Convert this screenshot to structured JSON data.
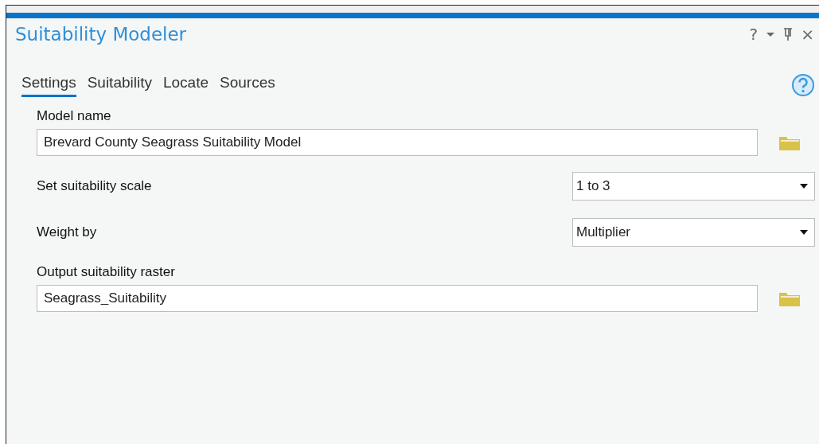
{
  "window": {
    "title": "Suitability Modeler",
    "controls": [
      "?",
      "×"
    ]
  },
  "tabs": [
    {
      "label": "Settings",
      "selected": true
    },
    {
      "label": "Suitability",
      "selected": false
    },
    {
      "label": "Locate",
      "selected": false
    },
    {
      "label": "Sources",
      "selected": false
    }
  ],
  "fields": [
    {
      "kind": "path",
      "label": "Model name",
      "value": "Brevard County Seagrass Suitability Model"
    },
    {
      "kind": "dropdown",
      "label": "Set suitability scale",
      "value": "1 to 3"
    },
    {
      "kind": "dropdown",
      "label": "Weight by",
      "value": "Multiplier"
    },
    {
      "kind": "path",
      "label": "Output suitability raster",
      "value": "Seagrass_Suitability"
    }
  ]
}
